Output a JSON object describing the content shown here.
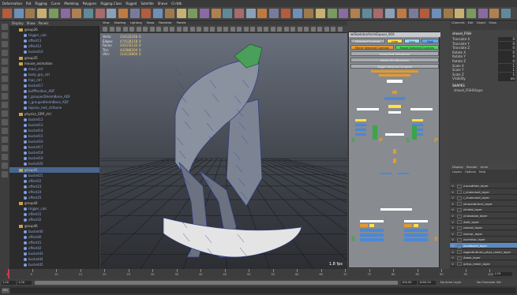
{
  "app": {
    "name": "Autodesk Maya"
  },
  "menubar": {
    "items": [
      "Deformation",
      "Rid",
      "Rigging",
      "Curve",
      "Modeling",
      "Polygons",
      "Rigging Class",
      "Rigged",
      "Satellite",
      "Shave",
      "Cl rbtk"
    ]
  },
  "outliner": {
    "menu": [
      "Display",
      "Show",
      "Panels"
    ],
    "rows": [
      {
        "label": "group26",
        "kind": "group",
        "indent": 2
      },
      {
        "label": "trigger_calc",
        "kind": "joint",
        "indent": 3
      },
      {
        "label": "offset11",
        "kind": "joint",
        "indent": 3
      },
      {
        "label": "offset12",
        "kind": "joint",
        "indent": 3
      },
      {
        "label": "bucket10",
        "kind": "joint",
        "indent": 3
      },
      {
        "label": "group35",
        "kind": "group",
        "indent": 2
      },
      {
        "label": "mouse_animation",
        "kind": "group",
        "indent": 2
      },
      {
        "label": "main_ctrl",
        "kind": "joint",
        "indent": 3
      },
      {
        "label": "body_grp_ctrl",
        "kind": "joint",
        "indent": 3
      },
      {
        "label": "hips_ctrl",
        "kind": "joint",
        "indent": 3
      },
      {
        "label": "bucket17",
        "kind": "joint",
        "indent": 3
      },
      {
        "label": "buffPosition_ADF",
        "kind": "joint",
        "indent": 3
      },
      {
        "label": "l_grouped1HelmBone_ADF",
        "kind": "joint",
        "indent": 3
      },
      {
        "label": "r_groupedHelmBone_ADF",
        "kind": "joint",
        "indent": 3
      },
      {
        "label": "topnav_rest_ctrlbone",
        "kind": "joint",
        "indent": 3
      },
      {
        "label": "physics_GRP_ctrl",
        "kind": "group",
        "indent": 2
      },
      {
        "label": "bucket12",
        "kind": "joint",
        "indent": 3
      },
      {
        "label": "bucket13",
        "kind": "joint",
        "indent": 3
      },
      {
        "label": "bucket14",
        "kind": "joint",
        "indent": 3
      },
      {
        "label": "bucket15",
        "kind": "joint",
        "indent": 3
      },
      {
        "label": "bucket16",
        "kind": "joint",
        "indent": 3
      },
      {
        "label": "bucket17",
        "kind": "joint",
        "indent": 3
      },
      {
        "label": "bucket18",
        "kind": "joint",
        "indent": 3
      },
      {
        "label": "bucket19",
        "kind": "joint",
        "indent": 3
      },
      {
        "label": "bucket20",
        "kind": "joint",
        "indent": 3
      },
      {
        "label": "group41",
        "kind": "group",
        "indent": 2,
        "selected": true
      },
      {
        "label": "bucket21",
        "kind": "joint",
        "indent": 3
      },
      {
        "label": "offset22",
        "kind": "joint",
        "indent": 3
      },
      {
        "label": "offset23",
        "kind": "joint",
        "indent": 3
      },
      {
        "label": "offset24",
        "kind": "joint",
        "indent": 3
      },
      {
        "label": "offset25",
        "kind": "joint",
        "indent": 3
      },
      {
        "label": "group44",
        "kind": "group",
        "indent": 2
      },
      {
        "label": "trigger_calc",
        "kind": "joint",
        "indent": 3
      },
      {
        "label": "offset31",
        "kind": "joint",
        "indent": 3
      },
      {
        "label": "offset32",
        "kind": "joint",
        "indent": 3
      },
      {
        "label": "group46",
        "kind": "group",
        "indent": 2
      },
      {
        "label": "bucket40",
        "kind": "joint",
        "indent": 3
      },
      {
        "label": "offset40",
        "kind": "joint",
        "indent": 3
      },
      {
        "label": "offset41",
        "kind": "joint",
        "indent": 3
      },
      {
        "label": "offset42",
        "kind": "joint",
        "indent": 3
      },
      {
        "label": "bucket43",
        "kind": "joint",
        "indent": 3
      },
      {
        "label": "bucket44",
        "kind": "joint",
        "indent": 3
      },
      {
        "label": "bucket45",
        "kind": "joint",
        "indent": 3
      }
    ]
  },
  "viewport": {
    "menu": [
      "View",
      "Shading",
      "Lighting",
      "Show",
      "Renderer",
      "Panels"
    ],
    "hud": [
      {
        "label": "Verts:",
        "a": "23412",
        "b": "2268",
        "c": "0"
      },
      {
        "label": "Edges:",
        "a": "47412",
        "b": "4218",
        "c": "0"
      },
      {
        "label": "Faces:",
        "a": "24127",
        "b": "2132",
        "c": "0"
      },
      {
        "label": "Tris:",
        "a": "44284",
        "b": "4264",
        "c": "0"
      },
      {
        "label": "UVs:",
        "a": "31413",
        "b": "3800",
        "c": "0"
      }
    ],
    "fps": "1.8 fps"
  },
  "picker": {
    "title": "wtSkeletonAnimExpoal_00X",
    "mode_buttons": [
      "Selected Controls",
      "Hide",
      "Lhm",
      "High"
    ],
    "row2": [
      "Mirror Selected Controls",
      "Reset Selected Controls"
    ],
    "full_buttons": [
      "Show/Hide Influences",
      "Select All Influences",
      "Toggle Bodyline Scripted"
    ],
    "side_labels": [
      "S",
      "P",
      "S",
      "P",
      "S",
      "S"
    ]
  },
  "channelbox": {
    "tabs": [
      "Channels",
      "Edit",
      "Object",
      "Show"
    ],
    "object": "shovel_FISH",
    "channels": [
      {
        "name": "Translate X",
        "value": "0"
      },
      {
        "name": "Translate Y",
        "value": "0"
      },
      {
        "name": "Translate Z",
        "value": "0"
      },
      {
        "name": "Rotate X",
        "value": "0"
      },
      {
        "name": "Rotate Y",
        "value": "0"
      },
      {
        "name": "Rotate Z",
        "value": "0"
      },
      {
        "name": "Scale X",
        "value": "1"
      },
      {
        "name": "Scale Y",
        "value": "1"
      },
      {
        "name": "Scale Z",
        "value": "1"
      },
      {
        "name": "Visibility",
        "value": "on"
      }
    ],
    "shapes_header": "SHAPES",
    "shape": "shovel_FISHShape"
  },
  "layers": {
    "tabs": [
      "Display",
      "Render",
      "Anim"
    ],
    "menu": [
      "Layers",
      "Options",
      "Help"
    ],
    "rows": [
      {
        "v": "V",
        "label": "/roundHair_layer"
      },
      {
        "v": "V",
        "label": "/_chainmail_layer"
      },
      {
        "v": "V",
        "label": "/_chainmail_layer"
      },
      {
        "v": "V",
        "label": "/shoulderArm_layer"
      },
      {
        "v": "V",
        "label": "/shield_layer"
      },
      {
        "v": "V",
        "label": "/crossbow_layer"
      },
      {
        "v": "V",
        "label": "/belt_layer"
      },
      {
        "v": "V",
        "label": "/sword_layer"
      },
      {
        "v": "V",
        "label": "/armor_layer"
      },
      {
        "v": "V",
        "label": "/scimitar_layer"
      },
      {
        "v": "V",
        "label": "/scabbard_layer",
        "selected": true
      },
      {
        "v": "V",
        "label": "/agentInAnim_phys_mesh_layer"
      },
      {
        "v": "V",
        "label": "/base_layer"
      },
      {
        "v": "V",
        "label": "/phys_mesh_layer"
      }
    ]
  },
  "timeline": {
    "ticks": [
      "1",
      "5",
      "10",
      "15",
      "20",
      "25",
      "30",
      "35",
      "40",
      "45",
      "50",
      "55",
      "60",
      "65",
      "70",
      "75",
      "80",
      "85",
      "90",
      "95",
      "100"
    ],
    "current": "1.00",
    "range": {
      "start": "1.00",
      "inner_start": "1.00",
      "inner_end": "100.00",
      "end": "100.00",
      "anim_end": "1000.00"
    },
    "anim_layer": "No Anim Layer",
    "char_set": "No Character Set"
  },
  "colors": {
    "accent_selected": "#48658f",
    "layer_selected": "#5b8ac0",
    "picker_orange": "#e39a31",
    "picker_yellow": "#ffe04a",
    "picker_blue": "#4b87d6",
    "picker_green": "#3aa54a"
  }
}
